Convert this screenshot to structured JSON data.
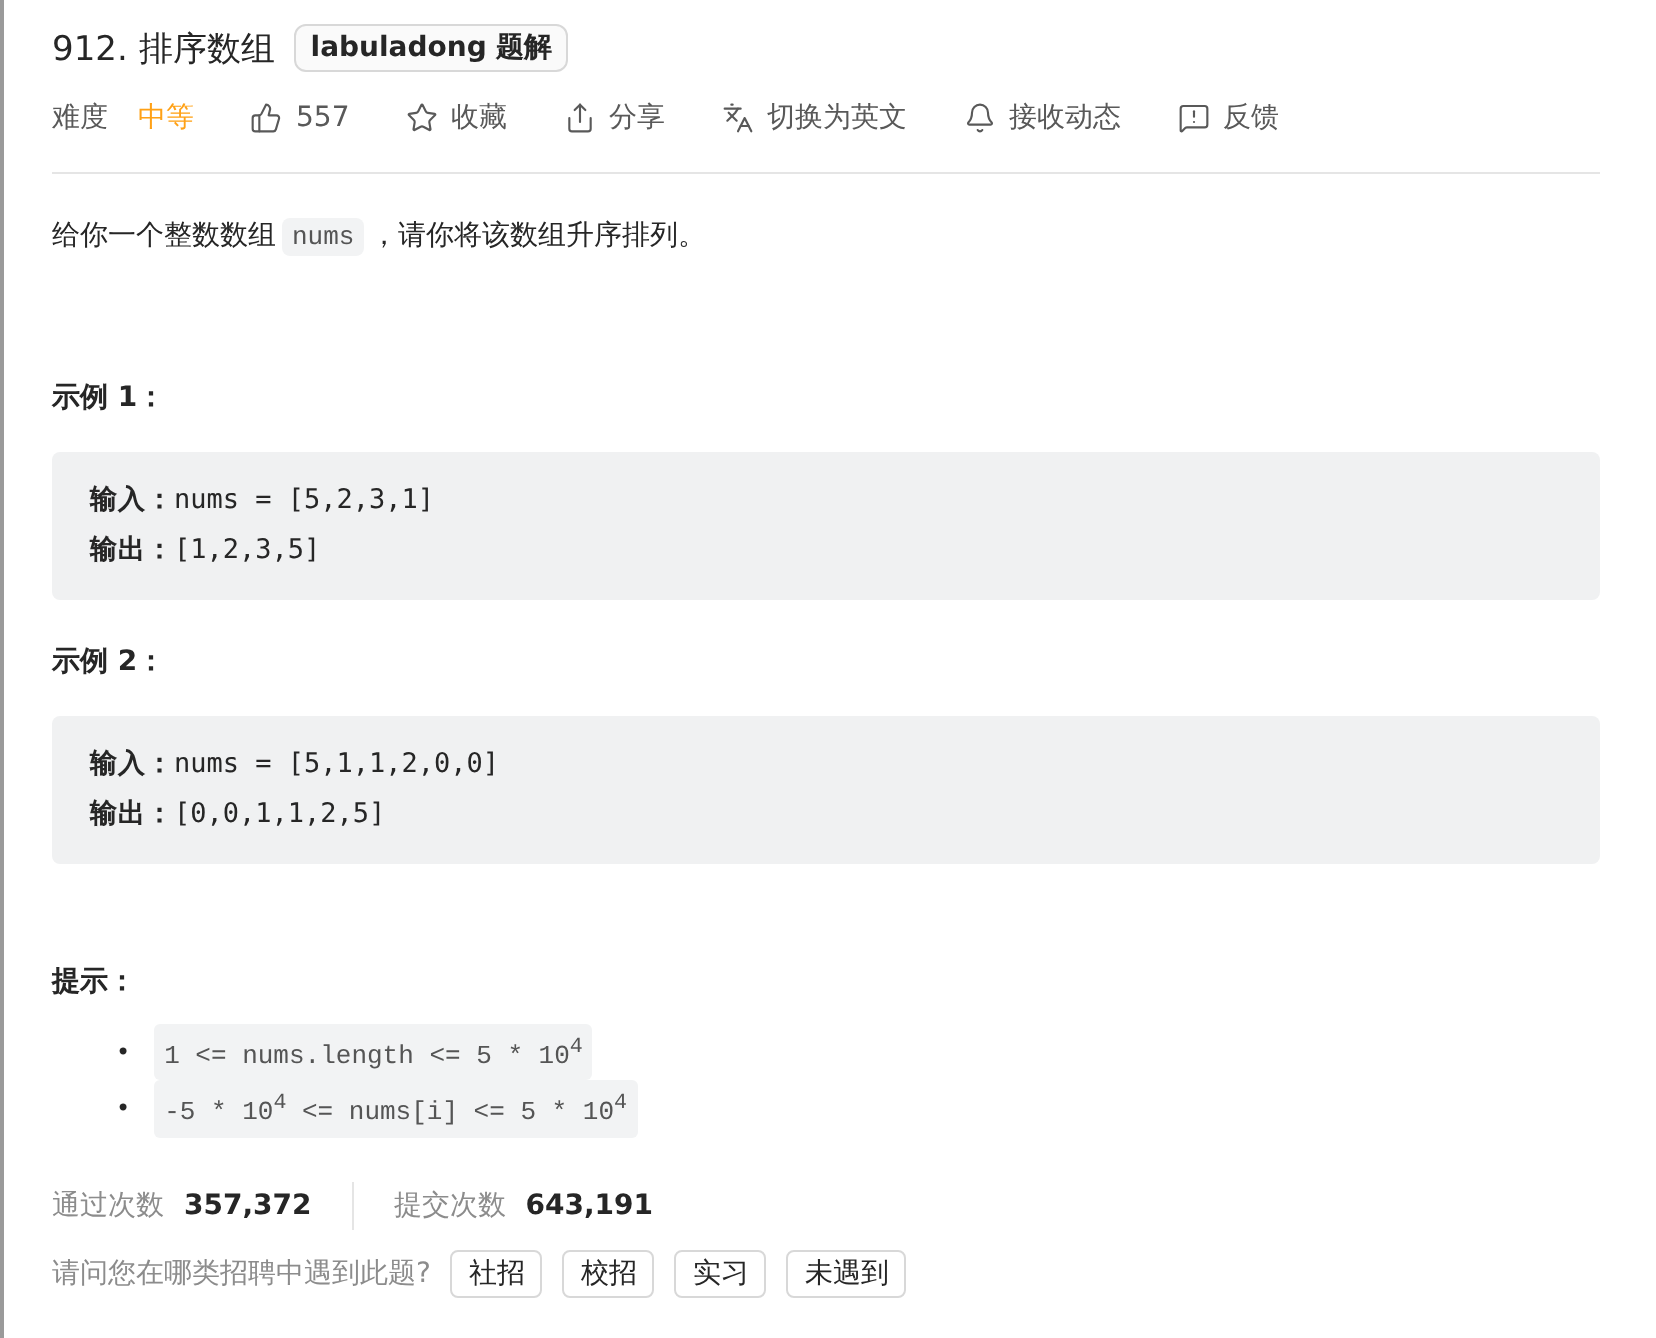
{
  "title": "912. 排序数组",
  "badge": "labuladong 题解",
  "meta": [
    {
      "kind": "difficulty",
      "label": "难度",
      "value": "中等"
    },
    {
      "kind": "like",
      "label": "557"
    },
    {
      "kind": "star",
      "label": "收藏"
    },
    {
      "kind": "share",
      "label": "分享"
    },
    {
      "kind": "translate",
      "label": "切换为英文"
    },
    {
      "kind": "bell",
      "label": "接收动态"
    },
    {
      "kind": "feedback",
      "label": "反馈"
    }
  ],
  "description": {
    "before": "给你一个整数数组",
    "code": "nums",
    "after": "，请你将该数组升序排列。"
  },
  "examples": [
    {
      "heading": "示例 1：",
      "input_label": "输入：",
      "input": "nums = [5,2,3,1]",
      "output_label": "输出：",
      "output": "[1,2,3,5]"
    },
    {
      "heading": "示例 2：",
      "input_label": "输入：",
      "input": "nums = [5,1,1,2,0,0]",
      "output_label": "输出：",
      "output": "[0,0,1,1,2,5]"
    }
  ],
  "hints_heading": "提示：",
  "hints": [
    {
      "bullet": "•",
      "text": "1 <= nums.length <= 5 * 10$^{4}$"
    },
    {
      "bullet": "•",
      "text": "-5 * 10$^{4}$ <= nums[i] <= 5 * 10$^{4}$"
    }
  ],
  "stats": [
    {
      "label": "通过次数",
      "value": "357,372"
    },
    {
      "label": "提交次数",
      "value": "643,191"
    }
  ],
  "question": "请问您在哪类招聘中遇到此题?",
  "options": [
    "社招",
    "校招",
    "实习",
    "未遇到"
  ]
}
